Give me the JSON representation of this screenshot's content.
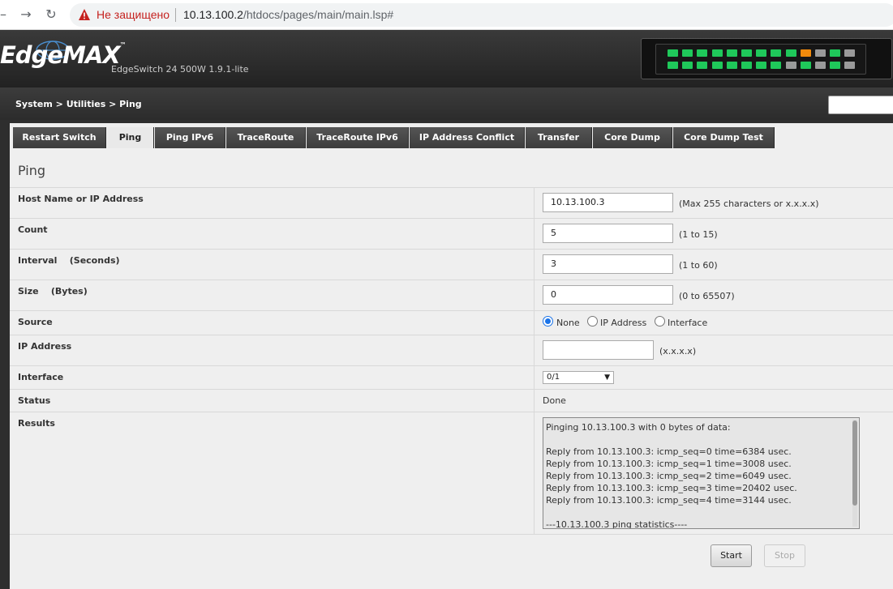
{
  "browser": {
    "warning": "Не защищено",
    "url_host": "10.13.100.2",
    "url_path": "/htdocs/pages/main/main.lsp#"
  },
  "header": {
    "logo": "EdgeMAX",
    "logo_tm": "™",
    "model": "EdgeSwitch 24 500W 1.9.1-lite",
    "port_colors": {
      "up": "#1fc85a",
      "active": "#f08a0c",
      "down": "#9a9a9a"
    }
  },
  "breadcrumb": "System > Utilities > Ping",
  "tabs": [
    {
      "label": "Restart Switch",
      "active": false
    },
    {
      "label": "Ping",
      "active": true
    },
    {
      "label": "Ping IPv6",
      "active": false
    },
    {
      "label": "TraceRoute",
      "active": false
    },
    {
      "label": "TraceRoute IPv6",
      "active": false
    },
    {
      "label": "IP Address Conflict",
      "active": false
    },
    {
      "label": "Transfer",
      "active": false
    },
    {
      "label": "Core Dump",
      "active": false
    },
    {
      "label": "Core Dump Test",
      "active": false
    }
  ],
  "panel_title": "Ping",
  "form": {
    "host": {
      "label": "Host Name or IP Address",
      "value": "10.13.100.3",
      "hint": "(Max 255 characters or x.x.x.x)"
    },
    "count": {
      "label": "Count",
      "value": "5",
      "hint": "(1 to 15)"
    },
    "interval": {
      "label": "Interval    (Seconds)",
      "value": "3",
      "hint": "(1 to 60)"
    },
    "size": {
      "label": "Size    (Bytes)",
      "value": "0",
      "hint": "(0 to 65507)"
    },
    "source": {
      "label": "Source",
      "options": [
        "None",
        "IP Address",
        "Interface"
      ],
      "selected": "None"
    },
    "ip_address": {
      "label": "IP Address",
      "value": "",
      "hint": "(x.x.x.x)"
    },
    "interface": {
      "label": "Interface",
      "value": "0/1"
    },
    "status": {
      "label": "Status",
      "value": "Done"
    },
    "results": {
      "label": "Results",
      "lines": [
        "Pinging 10.13.100.3 with 0 bytes of data:",
        "",
        "Reply from 10.13.100.3: icmp_seq=0 time=6384 usec.",
        "Reply from 10.13.100.3: icmp_seq=1 time=3008 usec.",
        "Reply from 10.13.100.3: icmp_seq=2 time=6049 usec.",
        "Reply from 10.13.100.3: icmp_seq=3 time=20402 usec.",
        "Reply from 10.13.100.3: icmp_seq=4 time=3144 usec.",
        "",
        "---10.13.100.3 ping statistics----"
      ]
    }
  },
  "buttons": {
    "start": "Start",
    "stop": "Stop"
  }
}
